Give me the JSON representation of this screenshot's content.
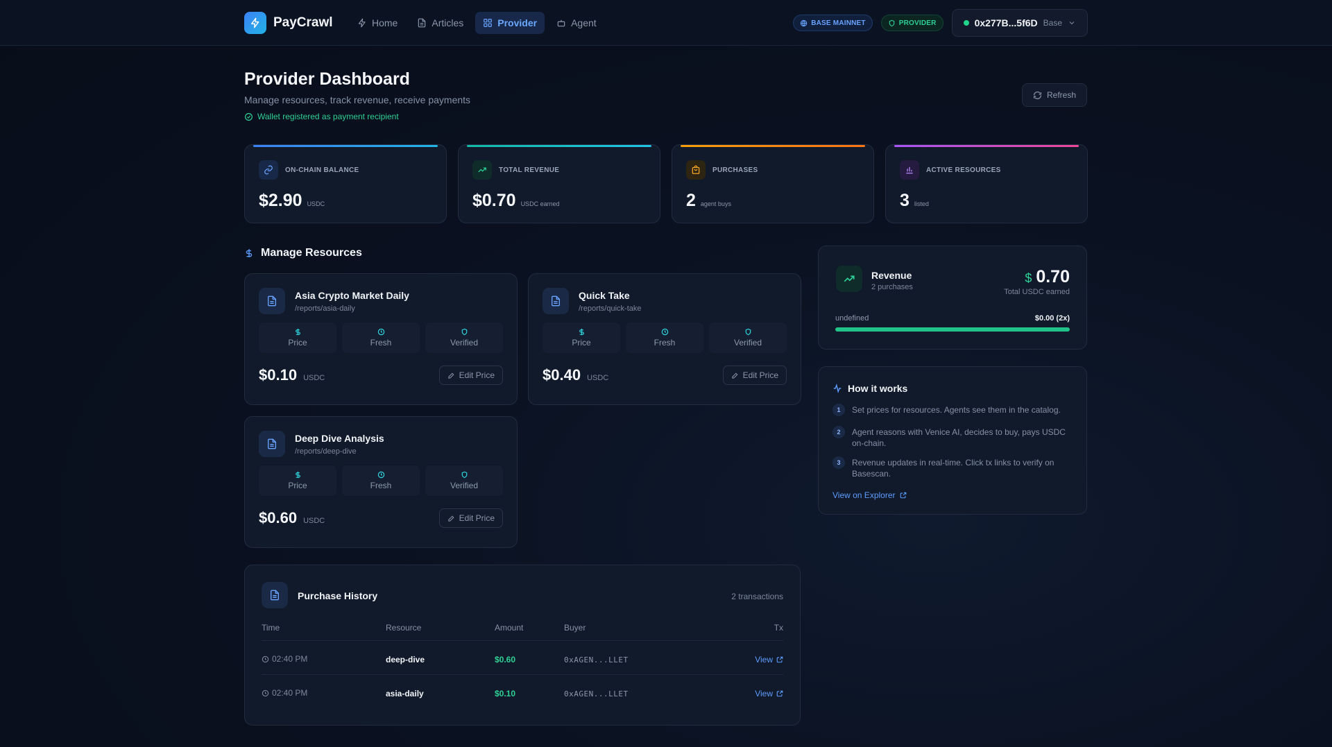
{
  "nav": {
    "brand": "PayCrawl",
    "links": [
      {
        "label": "Home",
        "icon": "lightning-icon"
      },
      {
        "label": "Articles",
        "icon": "document-icon"
      },
      {
        "label": "Provider",
        "icon": "grid-icon"
      },
      {
        "label": "Agent",
        "icon": "robot-icon"
      }
    ],
    "network_badge": "BASE MAINNET",
    "role_badge": "PROVIDER",
    "wallet_address": "0x277B...5f6D",
    "wallet_network": "Base"
  },
  "header": {
    "title": "Provider Dashboard",
    "subtitle": "Manage resources, track revenue, receive payments",
    "registered": "Wallet registered as payment recipient",
    "refresh_label": "Refresh"
  },
  "stats": [
    {
      "label": "ON-CHAIN BALANCE",
      "value": "$2.90",
      "unit": "USDC",
      "color": "#3b82f6"
    },
    {
      "label": "TOTAL REVENUE",
      "value": "$0.70",
      "unit": "USDC earned",
      "color": "#14b8a6"
    },
    {
      "label": "PURCHASES",
      "value": "2",
      "unit": "agent buys",
      "color": "#f59e0b"
    },
    {
      "label": "ACTIVE RESOURCES",
      "value": "3",
      "unit": "listed",
      "color": "#a855f7"
    }
  ],
  "manage": {
    "title": "Manage Resources",
    "features": [
      "Price",
      "Fresh",
      "Verified"
    ],
    "currency": "USDC",
    "edit_label": "Edit Price",
    "resources": [
      {
        "name": "Asia Crypto Market Daily",
        "path": "/reports/asia-daily",
        "price": "$0.10"
      },
      {
        "name": "Quick Take",
        "path": "/reports/quick-take",
        "price": "$0.40"
      },
      {
        "name": "Deep Dive Analysis",
        "path": "/reports/deep-dive",
        "price": "$0.60"
      }
    ]
  },
  "history": {
    "title": "Purchase History",
    "count": "2 transactions",
    "columns": [
      "Time",
      "Resource",
      "Amount",
      "Buyer",
      "Tx"
    ],
    "rows": [
      {
        "time": "02:40 PM",
        "resource": "deep-dive",
        "amount": "$0.60",
        "buyer": "0xAGEN...LLET",
        "tx": "View"
      },
      {
        "time": "02:40 PM",
        "resource": "asia-daily",
        "amount": "$0.10",
        "buyer": "0xAGEN...LLET",
        "tx": "View"
      }
    ]
  },
  "revenue": {
    "title": "Revenue",
    "purchases": "2 purchases",
    "currency_symbol": "$",
    "amount": "0.70",
    "amount_label": "Total USDC earned",
    "row_label": "undefined",
    "row_value": "$0.00 (2x)",
    "progress": 1.0
  },
  "how": {
    "title": "How it works",
    "steps": [
      {
        "n": "1",
        "text": "Set prices for resources. Agents see them in the catalog."
      },
      {
        "n": "2",
        "text": "Agent reasons with Venice AI, decides to buy, pays USDC on-chain."
      },
      {
        "n": "3",
        "text": "Revenue updates in real-time. Click tx links to verify on Basescan."
      }
    ],
    "explorer_link": "View on Explorer"
  }
}
